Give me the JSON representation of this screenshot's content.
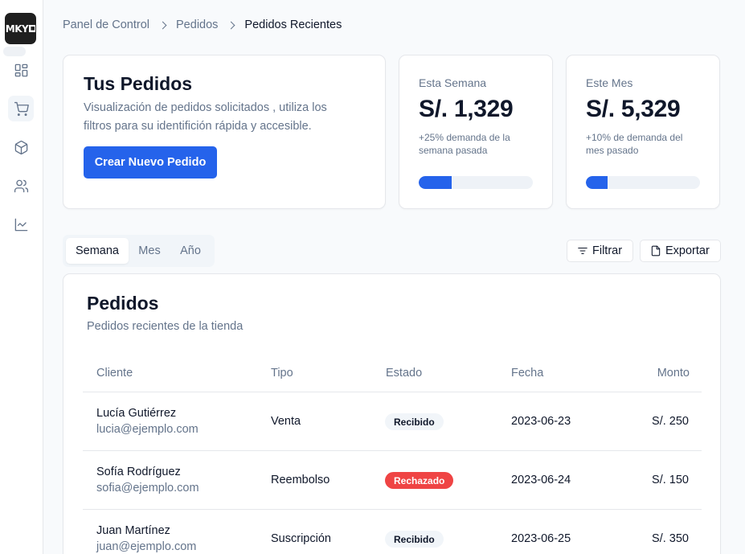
{
  "sidebar": {
    "logo_text": "MKY",
    "items": [
      {
        "icon": "dashboard-icon",
        "active": false
      },
      {
        "icon": "cart-icon",
        "active": true
      },
      {
        "icon": "package-icon",
        "active": false
      },
      {
        "icon": "users-icon",
        "active": false
      },
      {
        "icon": "chart-icon",
        "active": false
      }
    ]
  },
  "breadcrumb": [
    "Panel de Control",
    "Pedidos",
    "Pedidos Recientes"
  ],
  "hero": {
    "title": "Tus Pedidos",
    "description": "Visualización de pedidos solicitados , utiliza los filtros para su identifición rápida y accesible.",
    "button": "Crear Nuevo Pedido"
  },
  "stats": [
    {
      "label": "Esta Semana",
      "value": "S/. 1,329",
      "note": "+25% demanda de la semana pasada",
      "progress": 0.29
    },
    {
      "label": "Este Mes",
      "value": "S/. 5,329",
      "note": "+10% de demanda del mes pasado",
      "progress": 0.19
    }
  ],
  "tabs": [
    "Semana",
    "Mes",
    "Año"
  ],
  "active_tab": "Semana",
  "actions": {
    "filter": "Filtrar",
    "export": "Exportar"
  },
  "orders": {
    "title": "Pedidos",
    "subtitle": "Pedidos recientes de la tienda",
    "columns": [
      "Cliente",
      "Tipo",
      "Estado",
      "Fecha",
      "Monto"
    ],
    "rows": [
      {
        "name": "Lucía Gutiérrez",
        "email": "lucia@ejemplo.com",
        "type": "Venta",
        "status": "Recibido",
        "date": "2023-06-23",
        "amount": "S/. 250"
      },
      {
        "name": "Sofía Rodríguez",
        "email": "sofia@ejemplo.com",
        "type": "Reembolso",
        "status": "Rechazado",
        "date": "2023-06-24",
        "amount": "S/. 150"
      },
      {
        "name": "Juan Martínez",
        "email": "juan@ejemplo.com",
        "type": "Suscripción",
        "status": "Recibido",
        "date": "2023-06-25",
        "amount": "S/. 350"
      }
    ]
  },
  "colors": {
    "accent": "#2563eb",
    "danger": "#ef4444",
    "muted": "#64748b"
  }
}
